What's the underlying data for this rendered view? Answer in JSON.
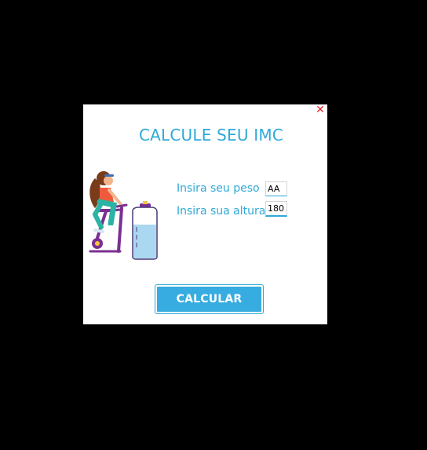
{
  "window": {
    "close_glyph": "✕",
    "title": "CALCULE SEU IMC"
  },
  "form": {
    "peso_label": "Insira seu peso",
    "peso_value": "AA",
    "altura_label": "Insira sua altura",
    "altura_value": "180"
  },
  "actions": {
    "calcular_label": "CALCULAR"
  },
  "illustration": {
    "icon": "woman-on-exercise-bike-illustration"
  },
  "colors": {
    "background": "#000000",
    "window": "#ffffff",
    "accent": "#2fa9d8",
    "button": "#36ace0",
    "close": "#e8262b"
  }
}
